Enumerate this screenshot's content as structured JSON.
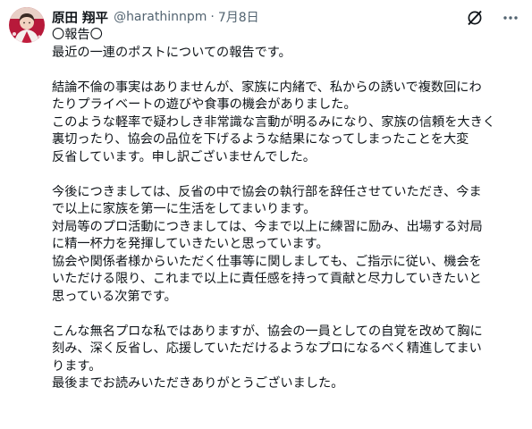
{
  "author": {
    "display_name": "原田 翔平",
    "handle": "@harathinnpm",
    "separator": "·",
    "date": "7月8日"
  },
  "icons": {
    "avatar": "avatar-image",
    "grok": "grok-icon",
    "more": "more-icon"
  },
  "post": {
    "paragraphs": [
      [
        "〇報告〇",
        "最近の一連のポストについての報告です。"
      ],
      [
        "結論不倫の事実はありませんが、家族に内緒で、私からの誘いで複数回にわ",
        "たりプライベートの遊びや食事の機会がありました。",
        "このような軽率で疑わしき非常識な言動が明るみになり、家族の信頼を大きく",
        "裏切ったり、協会の品位を下げるような結果になってしまったことを大変",
        "反省しています。申し訳ございませんでした。"
      ],
      [
        "今後につきましては、反省の中で協会の執行部を辞任させていただき、今ま",
        "で以上に家族を第一に生活をしてまいります。",
        "対局等のプロ活動につきましては、今まで以上に練習に励み、出場する対局",
        "に精一杯力を発揮していきたいと思っています。",
        "協会や関係者様からいただく仕事等に関しましても、ご指示に従い、機会を",
        "いただける限り、これまで以上に責任感を持って貢献と尽力していきたいと",
        "思っている次第です。"
      ],
      [
        "こんな無名プロな私ではありますが、協会の一員としての自覚を改めて胸に",
        "刻み、深く反省し、応援していただけるようなプロになるべく精進してまい",
        "ります。",
        "最後までお読みいただきありがとうございました。"
      ]
    ]
  },
  "colors": {
    "text": "#0f1419",
    "secondary": "#536471",
    "background": "#ffffff"
  }
}
